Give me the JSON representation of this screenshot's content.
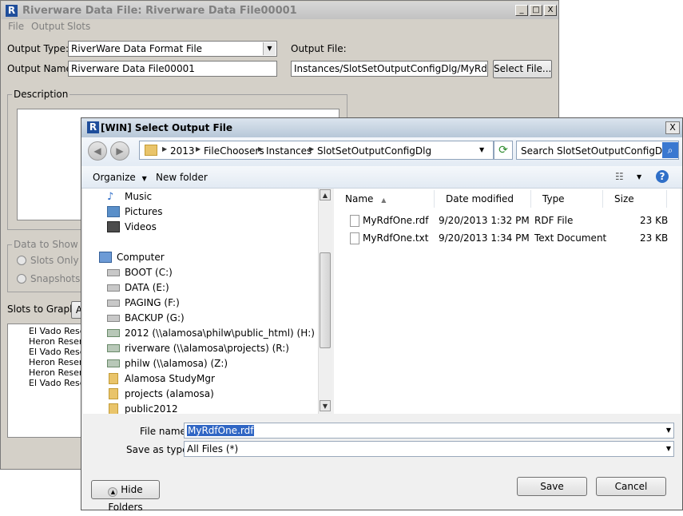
{
  "background_window": {
    "title": "Riverware Data File: Riverware Data File00001",
    "logo": "R",
    "controls": {
      "minimize": "_",
      "maximize": "□",
      "close": "X"
    },
    "menu": [
      "File",
      "Output",
      "Slots"
    ],
    "output_type_label": "Output Type:",
    "output_type_value": "RiverWare Data Format File",
    "output_name_label": "Output Name:",
    "output_name_value": "Riverware Data File00001",
    "output_file_label": "Output File:",
    "output_file_value": "Instances/SlotSetOutputConfigDlg/MyRdfOne.rdf",
    "select_file_button": "Select File...",
    "description_label": "Description",
    "data_to_show_label": "Data to Show in S",
    "radio_slots_only": "Slots Only",
    "radio_snapshots": "Snapshots an",
    "slots_to_graph_label": "Slots to Graph:",
    "slots_to_graph_button": "A",
    "slots": [
      "El Vado Reser",
      "Heron Reserv",
      "El Vado Reser",
      "Heron Reserv",
      "Heron Reserv",
      "El Vado Reser"
    ]
  },
  "dialog": {
    "title": "[WIN] Select Output File",
    "logo": "R",
    "close_glyph": "X",
    "nav": {
      "back_glyph": "◀",
      "forward_glyph": "▶"
    },
    "breadcrumb": [
      "2013",
      "FileChoosers",
      "Instances",
      "SlotSetOutputConfigDlg"
    ],
    "search_placeholder": "Search SlotSetOutputConfigDlg",
    "toolbar": {
      "organize": "Organize",
      "new_folder": "New folder"
    },
    "nav_items": [
      {
        "label": "Music",
        "icon": "music-icon"
      },
      {
        "label": "Pictures",
        "icon": "pictures-icon"
      },
      {
        "label": "Videos",
        "icon": "videos-icon"
      },
      {
        "label": "Computer",
        "icon": "computer-icon"
      },
      {
        "label": "BOOT (C:)",
        "icon": "drive-icon"
      },
      {
        "label": "DATA (E:)",
        "icon": "drive-icon"
      },
      {
        "label": "PAGING (F:)",
        "icon": "drive-icon"
      },
      {
        "label": "BACKUP (G:)",
        "icon": "drive-icon"
      },
      {
        "label": "2012 (\\\\alamosa\\philw\\public_html) (H:)",
        "icon": "network-drive-icon"
      },
      {
        "label": "riverware (\\\\alamosa\\projects) (R:)",
        "icon": "network-drive-icon"
      },
      {
        "label": "philw (\\\\alamosa) (Z:)",
        "icon": "network-drive-icon"
      },
      {
        "label": "Alamosa StudyMgr",
        "icon": "folder-icon"
      },
      {
        "label": "projects (alamosa)",
        "icon": "folder-icon"
      },
      {
        "label": "public2012",
        "icon": "folder-icon"
      }
    ],
    "columns": [
      "Name",
      "Date modified",
      "Type",
      "Size"
    ],
    "files": [
      {
        "name": "MyRdfOne.rdf",
        "date": "9/20/2013 1:32 PM",
        "type": "RDF File",
        "size": "23 KB"
      },
      {
        "name": "MyRdfOne.txt",
        "date": "9/20/2013 1:34 PM",
        "type": "Text Document",
        "size": "23 KB"
      }
    ],
    "file_name_label": "File name:",
    "file_name_value": "MyRdfOne.rdf",
    "save_as_type_label": "Save as type:",
    "save_as_type_value": "All Files (*)",
    "hide_folders": "Hide Folders",
    "save_button": "Save",
    "cancel_button": "Cancel"
  }
}
